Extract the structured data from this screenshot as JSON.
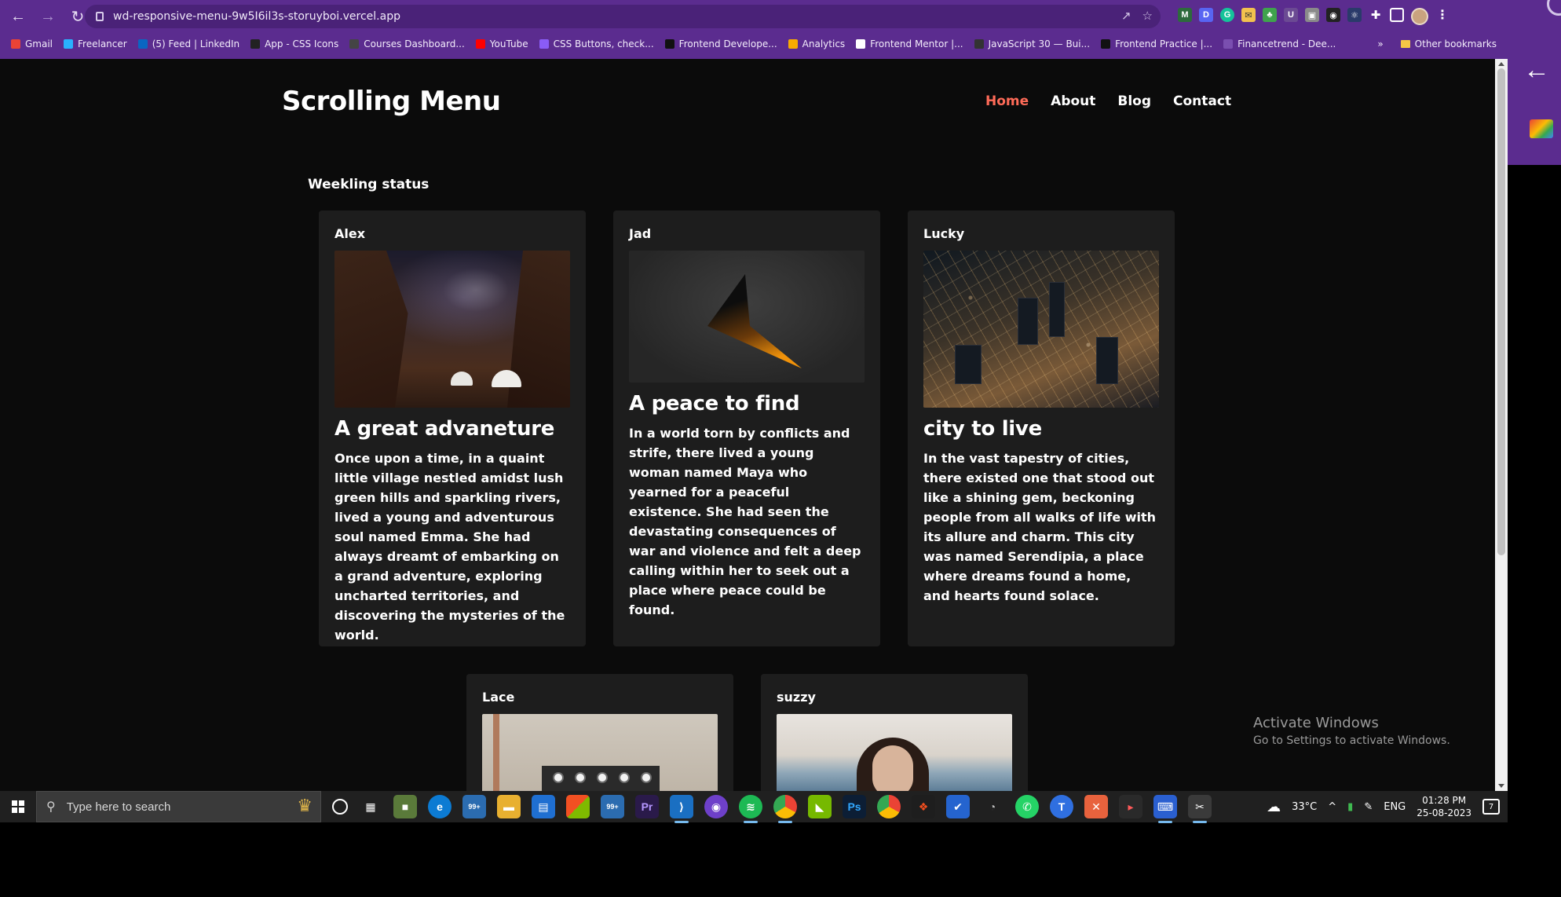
{
  "browser": {
    "url": "wd-responsive-menu-9w5I6il3s-storuyboi.vercel.app",
    "bookmarks": [
      {
        "label": "Gmail",
        "color": "#ea4335"
      },
      {
        "label": "Freelancer",
        "color": "#29b2fe"
      },
      {
        "label": "(5) Feed | LinkedIn",
        "color": "#0a66c2"
      },
      {
        "label": "App - CSS Icons",
        "color": "#222222"
      },
      {
        "label": "Courses Dashboard...",
        "color": "#444444"
      },
      {
        "label": "YouTube",
        "color": "#ff0000"
      },
      {
        "label": "CSS Buttons, check...",
        "color": "#8a5cf6"
      },
      {
        "label": "Frontend Develope...",
        "color": "#111111"
      },
      {
        "label": "Analytics",
        "color": "#f9ab00"
      },
      {
        "label": "Frontend Mentor |...",
        "color": "#ffffff"
      },
      {
        "label": "JavaScript 30 — Bui...",
        "color": "#333333"
      },
      {
        "label": "Frontend Practice |...",
        "color": "#111111"
      },
      {
        "label": "Financetrend - Dee...",
        "color": "#7a4fb0"
      }
    ],
    "overflow_label": "»",
    "other_bookmarks": "Other bookmarks"
  },
  "site": {
    "title": "Scrolling Menu",
    "nav": [
      "Home",
      "About",
      "Blog",
      "Contact"
    ],
    "active_nav": "Home",
    "accent": "#ff6b58",
    "section_title": "Weekling status"
  },
  "cards": [
    {
      "name": "Alex",
      "title": "A great advaneture",
      "body": "Once upon a time, in a quaint little village nestled amidst lush green hills and sparkling rivers, lived a young and adventurous soul named Emma. She had always dreamt of embarking on a grand adventure, exploring uncharted territories, and discovering the mysteries of the world."
    },
    {
      "name": "Jad",
      "title": "A peace to find",
      "body": "In a world torn by conflicts and strife, there lived a young woman named Maya who yearned for a peaceful existence. She had seen the devastating consequences of war and violence and felt a deep calling within her to seek out a place where peace could be found."
    },
    {
      "name": "Lucky",
      "title": "city to live",
      "body": "In the vast tapestry of cities, there existed one that stood out like a shining gem, beckoning people from all walks of life with its allure and charm. This city was named Serendipia, a place where dreams found a home, and hearts found solace."
    },
    {
      "name": "Lace"
    },
    {
      "name": "suzzy"
    }
  ],
  "watermark": {
    "line1": "Activate Windows",
    "line2": "Go to Settings to activate Windows."
  },
  "taskbar": {
    "search_placeholder": "Type here to search",
    "weather": "33°C",
    "language": "ENG",
    "time": "01:28 PM",
    "date": "25-08-2023",
    "notifications": "7",
    "badge_99": "99+"
  }
}
